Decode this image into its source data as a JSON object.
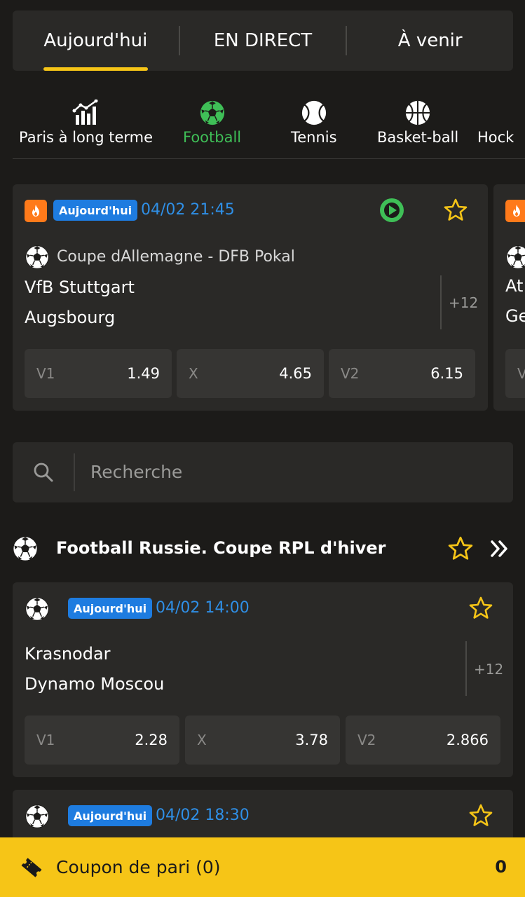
{
  "tabs": [
    {
      "label": "Aujourd'hui",
      "active": true
    },
    {
      "label": "EN DIRECT",
      "active": false
    },
    {
      "label": "À venir",
      "active": false
    }
  ],
  "sports": [
    {
      "label": "Paris à long terme",
      "icon": "chart-bars-icon"
    },
    {
      "label": "Football",
      "icon": "soccer-ball-icon",
      "active": true
    },
    {
      "label": "Tennis",
      "icon": "tennis-ball-icon"
    },
    {
      "label": "Basket-ball",
      "icon": "basketball-icon"
    },
    {
      "label": "Hock",
      "icon": "hockey-icon"
    }
  ],
  "featured": [
    {
      "badge": "Aujourd'hui",
      "time": "04/02 21:45",
      "league": "Coupe dAllemagne - DFB Pokal",
      "team1": "VfB Stuttgart",
      "team2": "Augsbourg",
      "more": "+12",
      "odds": [
        {
          "k": "V1",
          "v": "1.49"
        },
        {
          "k": "X",
          "v": "4.65"
        },
        {
          "k": "V2",
          "v": "6.15"
        }
      ]
    },
    {
      "team1": "At",
      "team2": "Ge",
      "odd_k": "V"
    }
  ],
  "search": {
    "placeholder": "Recherche"
  },
  "league_section": {
    "title": "Football Russie. Coupe RPL d'hiver"
  },
  "matches": [
    {
      "badge": "Aujourd'hui",
      "time": "04/02 14:00",
      "team1": "Krasnodar",
      "team2": "Dynamo Moscou",
      "more": "+12",
      "odds": [
        {
          "k": "V1",
          "v": "2.28"
        },
        {
          "k": "X",
          "v": "3.78"
        },
        {
          "k": "V2",
          "v": "2.866"
        }
      ]
    },
    {
      "badge": "Aujourd'hui",
      "time": "04/02 18:30"
    }
  ],
  "coupon": {
    "label": "Coupon de pari (0)",
    "count": "0"
  },
  "colors": {
    "accent": "#f6c517",
    "live_green": "#3fbf57",
    "blue": "#1e7ce0",
    "card": "#2a2927",
    "bg": "#1c1b19"
  }
}
